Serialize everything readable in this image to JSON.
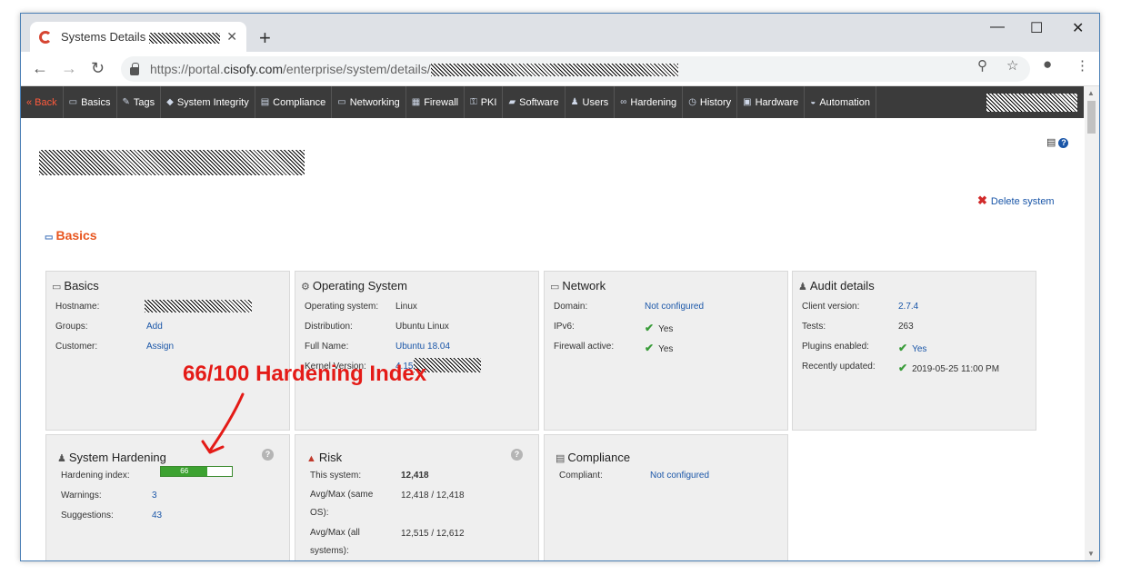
{
  "browser": {
    "tab_title": "Systems Details",
    "tab_close": "✕",
    "new_tab": "+",
    "url_prefix": "https://portal.",
    "url_domain": "cisofy.com",
    "url_path": "/enterprise/system/details/",
    "win_minimize": "—",
    "win_maximize": "☐",
    "win_close": "✕"
  },
  "sitenav": {
    "items": [
      {
        "label": "« Back",
        "icon": ""
      },
      {
        "label": "Basics",
        "icon": "▭"
      },
      {
        "label": "Tags",
        "icon": "✎"
      },
      {
        "label": "System Integrity",
        "icon": "◆"
      },
      {
        "label": "Compliance",
        "icon": "▤"
      },
      {
        "label": "Networking",
        "icon": "▭"
      },
      {
        "label": "Firewall",
        "icon": "▦"
      },
      {
        "label": "PKI",
        "icon": "⚿"
      },
      {
        "label": "Software",
        "icon": "▰"
      },
      {
        "label": "Users",
        "icon": "♟"
      },
      {
        "label": "Hardening",
        "icon": "∞"
      },
      {
        "label": "History",
        "icon": "◷"
      },
      {
        "label": "Hardware",
        "icon": "▣"
      },
      {
        "label": "Automation",
        "icon": "◒"
      }
    ]
  },
  "page": {
    "delete_label": "Delete system",
    "section_title": "Basics"
  },
  "cards": {
    "basics": {
      "title": "Basics",
      "rows": [
        {
          "label": "Hostname:",
          "value": ""
        },
        {
          "label": "Groups:",
          "value": "Add"
        },
        {
          "label": "Customer:",
          "value": "Assign"
        }
      ]
    },
    "os": {
      "title": "Operating System",
      "rows": [
        {
          "label": "Operating system:",
          "value": "Linux"
        },
        {
          "label": "Distribution:",
          "value": "Ubuntu Linux"
        },
        {
          "label": "Full Name:",
          "value": "Ubuntu 18.04"
        },
        {
          "label": "Kernel Version:",
          "value": "4.15"
        }
      ]
    },
    "network": {
      "title": "Network",
      "rows": [
        {
          "label": "Domain:",
          "value": "Not configured"
        },
        {
          "label": "IPv6:",
          "value": "Yes"
        },
        {
          "label": "Firewall active:",
          "value": "Yes"
        }
      ]
    },
    "audit": {
      "title": "Audit details",
      "rows": [
        {
          "label": "Client version:",
          "value": "2.7.4"
        },
        {
          "label": "Tests:",
          "value": "263"
        },
        {
          "label": "Plugins enabled:",
          "value": "Yes"
        },
        {
          "label": "Recently updated:",
          "value": "2019-05-25 11:00 PM"
        }
      ]
    },
    "hardening": {
      "title": "System Hardening",
      "index_label": "Hardening index:",
      "index_value": "66",
      "index_fraction": 0.66,
      "rows": [
        {
          "label": "Warnings:",
          "value": "3"
        },
        {
          "label": "Suggestions:",
          "value": "43"
        }
      ]
    },
    "risk": {
      "title": "Risk",
      "rows": [
        {
          "label": "This system:",
          "value": "12,418"
        },
        {
          "label": "Avg/Max (same OS):",
          "value": "12,418 / 12,418"
        },
        {
          "label": "Avg/Max (all systems):",
          "value": "12,515 / 12,612"
        }
      ]
    },
    "compliance": {
      "title": "Compliance",
      "rows": [
        {
          "label": "Compliant:",
          "value": "Not configured"
        }
      ]
    }
  },
  "annotation": {
    "text": "66/100 Hardening Index"
  },
  "colors": {
    "nav_bg": "#3b3b3b",
    "accent_orange": "#e8561f",
    "link_blue": "#1a56a8",
    "check_green": "#3a9c3a",
    "annotation_red": "#e41b17",
    "bar_green": "#3da231"
  }
}
